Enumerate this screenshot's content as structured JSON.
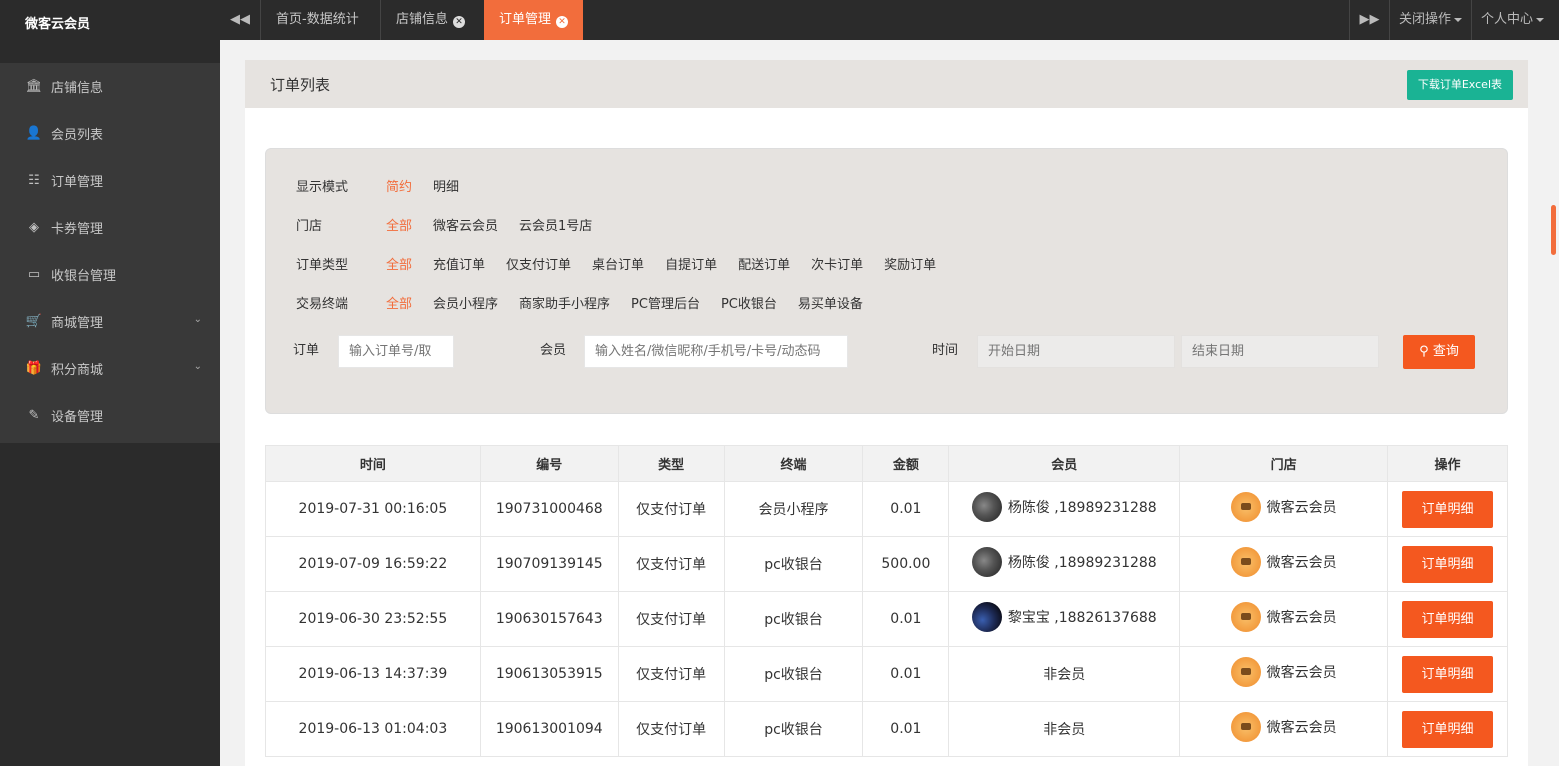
{
  "brand": "微客云会员",
  "sidebar": {
    "items": [
      {
        "label": "店铺信息",
        "icon": "bank-icon",
        "glyph": "🏛",
        "expandable": false
      },
      {
        "label": "会员列表",
        "icon": "user-icon",
        "glyph": "👤",
        "expandable": false
      },
      {
        "label": "订单管理",
        "icon": "list-icon",
        "glyph": "☷",
        "expandable": false
      },
      {
        "label": "卡券管理",
        "icon": "tag-icon",
        "glyph": "◈",
        "expandable": false
      },
      {
        "label": "收银台管理",
        "icon": "desktop-icon",
        "glyph": "▭",
        "expandable": false
      },
      {
        "label": "商城管理",
        "icon": "cart-icon",
        "glyph": "🛒",
        "expandable": true
      },
      {
        "label": "积分商城",
        "icon": "gift-icon",
        "glyph": "🎁",
        "expandable": true
      },
      {
        "label": "设备管理",
        "icon": "plug-icon",
        "glyph": "✎",
        "expandable": false
      }
    ]
  },
  "topbar": {
    "tabs": [
      {
        "label": "首页-数据统计",
        "closable": false,
        "active": false
      },
      {
        "label": "店铺信息",
        "closable": true,
        "active": false
      },
      {
        "label": "订单管理",
        "closable": true,
        "active": true
      }
    ],
    "close_ops": "关闭操作",
    "profile": "个人中心"
  },
  "panel": {
    "title": "订单列表",
    "excel_button": "下载订单Excel表"
  },
  "filters": {
    "display_mode": {
      "label": "显示模式",
      "options": [
        "简约",
        "明细"
      ],
      "selected": "简约"
    },
    "store": {
      "label": "门店",
      "options": [
        "全部",
        "微客云会员",
        "云会员1号店"
      ],
      "selected": "全部"
    },
    "order_type": {
      "label": "订单类型",
      "options": [
        "全部",
        "充值订单",
        "仅支付订单",
        "桌台订单",
        "自提订单",
        "配送订单",
        "次卡订单",
        "奖励订单"
      ],
      "selected": "全部"
    },
    "terminal": {
      "label": "交易终端",
      "options": [
        "全部",
        "会员小程序",
        "商家助手小程序",
        "PC管理后台",
        "PC收银台",
        "易买单设备"
      ],
      "selected": "全部"
    },
    "order_label": "订单",
    "order_placeholder": "输入订单号/取",
    "member_label": "会员",
    "member_placeholder": "输入姓名/微信昵称/手机号/卡号/动态码",
    "time_label": "时间",
    "start_placeholder": "开始日期",
    "end_placeholder": "结束日期",
    "query_button": "查询"
  },
  "table": {
    "headers": [
      "时间",
      "编号",
      "类型",
      "终端",
      "金额",
      "会员",
      "门店",
      "操作"
    ],
    "rows": [
      {
        "time": "2019-07-31 00:16:05",
        "id": "190731000468",
        "type": "仅支付订单",
        "terminal": "会员小程序",
        "amount": "0.01",
        "member": "杨陈俊 ,18989231288",
        "member_avatar": "gray",
        "store": "微客云会员",
        "action": "订单明细"
      },
      {
        "time": "2019-07-09 16:59:22",
        "id": "190709139145",
        "type": "仅支付订单",
        "terminal": "pc收银台",
        "amount": "500.00",
        "member": "杨陈俊 ,18989231288",
        "member_avatar": "gray",
        "store": "微客云会员",
        "action": "订单明细"
      },
      {
        "time": "2019-06-30 23:52:55",
        "id": "190630157643",
        "type": "仅支付订单",
        "terminal": "pc收银台",
        "amount": "0.01",
        "member": "黎宝宝 ,18826137688",
        "member_avatar": "dark",
        "store": "微客云会员",
        "action": "订单明细"
      },
      {
        "time": "2019-06-13 14:37:39",
        "id": "190613053915",
        "type": "仅支付订单",
        "terminal": "pc收银台",
        "amount": "0.01",
        "member": "非会员",
        "member_avatar": "",
        "store": "微客云会员",
        "action": "订单明细"
      },
      {
        "time": "2019-06-13 01:04:03",
        "id": "190613001094",
        "type": "仅支付订单",
        "terminal": "pc收银台",
        "amount": "0.01",
        "member": "非会员",
        "member_avatar": "",
        "store": "微客云会员",
        "action": "订单明细"
      }
    ]
  },
  "colors": {
    "accent": "#f26d3c",
    "button": "#f4581f",
    "excel": "#1ab394",
    "sidebar": "#2b2b2b"
  }
}
